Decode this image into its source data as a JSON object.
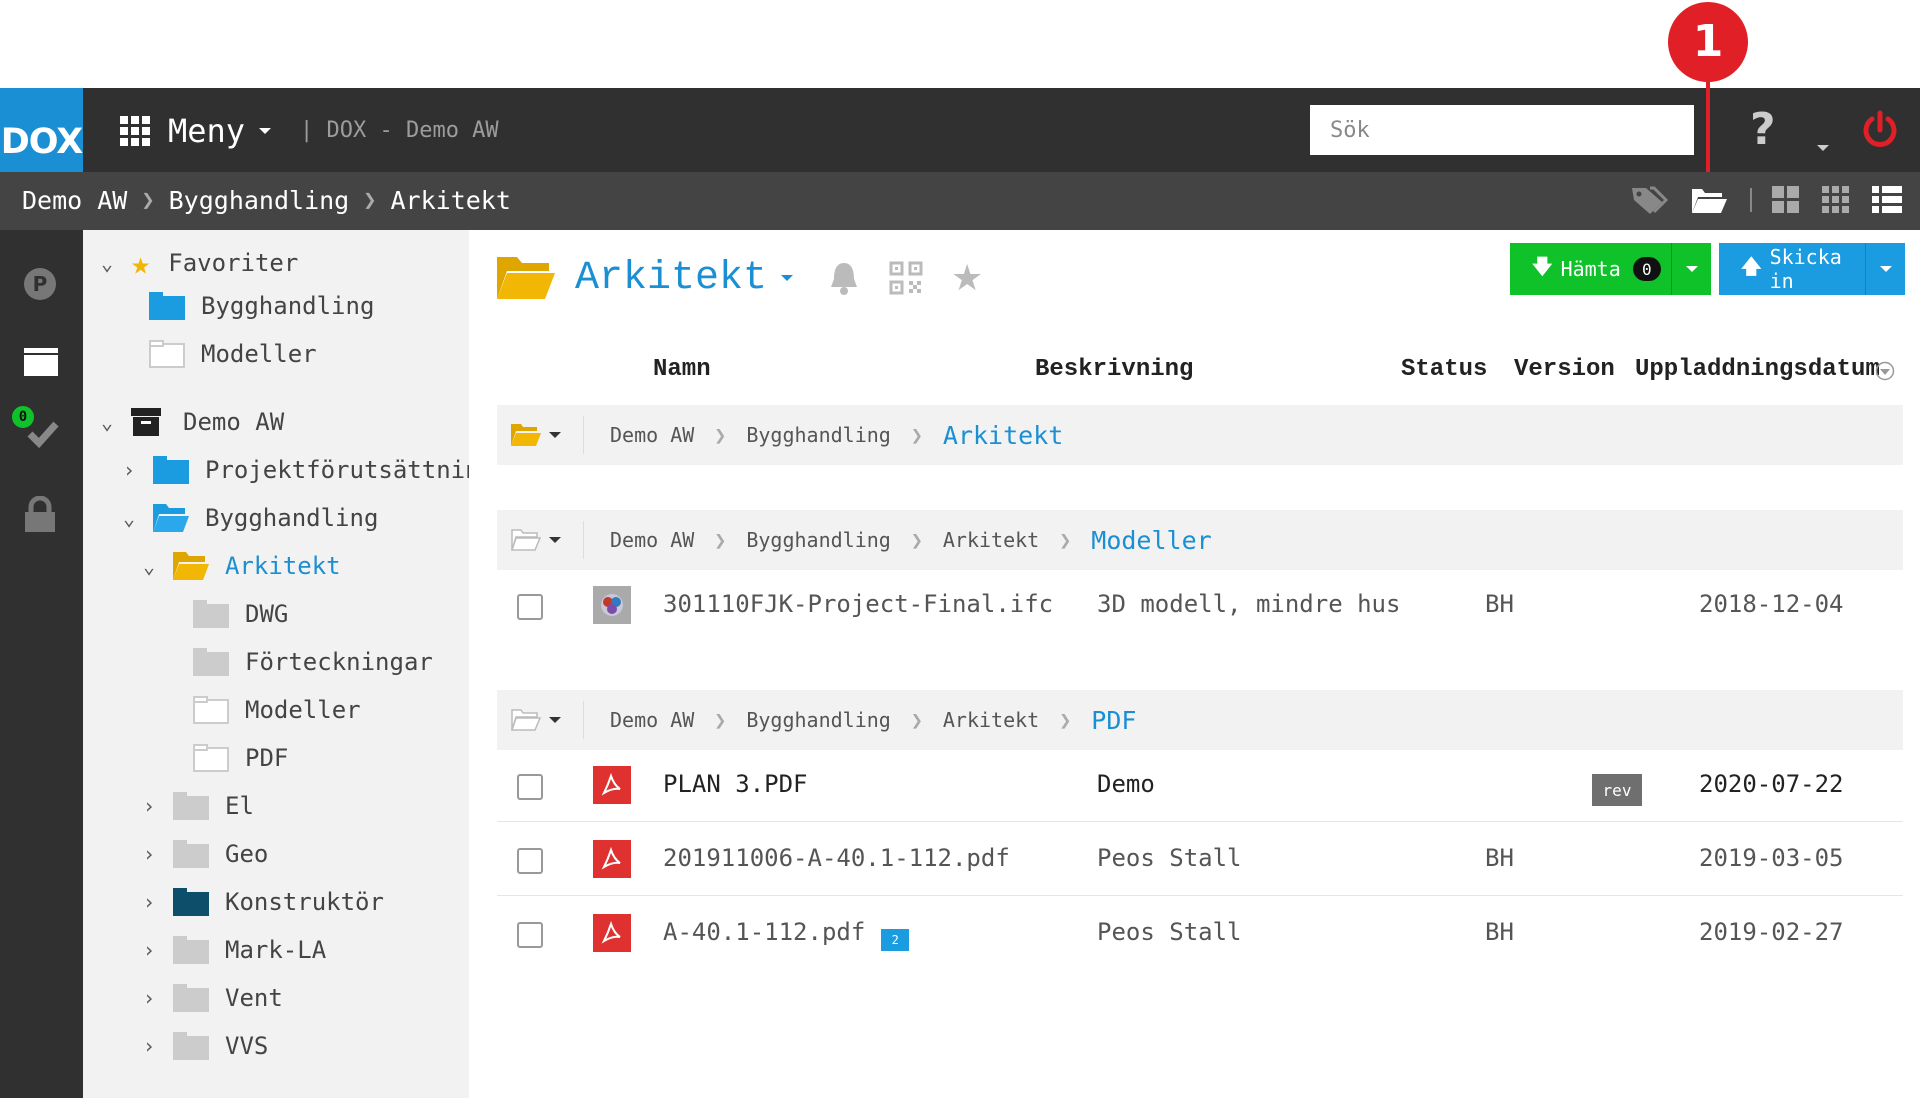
{
  "header": {
    "logo": "DOX",
    "menu_label": "Meny",
    "app_name": "| DOX - Demo AW",
    "search_placeholder": "Sök",
    "help_label": "?"
  },
  "callout": {
    "number": "1"
  },
  "breadcrumb": [
    "Demo AW",
    "Bygghandling",
    "Arkitekt"
  ],
  "toolbar_icons": [
    "tags-icon",
    "open-folder-icon",
    "large-grid-icon",
    "small-grid-icon",
    "list-view-icon"
  ],
  "rail": {
    "tasks_badge": "0"
  },
  "tree": {
    "favorites_label": "Favoriter",
    "favorites": [
      "Bygghandling",
      "Modeller"
    ],
    "project_label": "Demo AW",
    "folders": {
      "projekt": "Projektförutsättningar",
      "bygg": "Bygghandling",
      "arkitekt": "Arkitekt",
      "dwg": "DWG",
      "forteck": "Förteckningar",
      "modeller": "Modeller",
      "pdf": "PDF",
      "el": "El",
      "geo": "Geo",
      "konstr": "Konstruktör",
      "mark": "Mark-LA",
      "vent": "Vent",
      "vvs": "VVS"
    }
  },
  "main": {
    "title": "Arkitekt",
    "btn_hamta": "Hämta",
    "hamta_count": "0",
    "btn_skicka": "Skicka in",
    "columns": {
      "name": "Namn",
      "desc": "Beskrivning",
      "status": "Status",
      "version": "Version",
      "date": "Uppladdningsdatum"
    }
  },
  "groups": [
    {
      "path": [
        "Demo AW",
        "Bygghandling"
      ],
      "leaf": "Arkitekt"
    },
    {
      "path": [
        "Demo AW",
        "Bygghandling",
        "Arkitekt"
      ],
      "leaf": "Modeller"
    },
    {
      "path": [
        "Demo AW",
        "Bygghandling",
        "Arkitekt"
      ],
      "leaf": "PDF"
    }
  ],
  "files": [
    {
      "name": "301110FJK-Project-Final.ifc",
      "desc": "3D modell, mindre hus",
      "status": "BH",
      "date": "2018-12-04"
    },
    {
      "name": "PLAN 3.PDF",
      "desc": "Demo",
      "version": "rev",
      "date": "2020-07-22"
    },
    {
      "name": "201911006-A-40.1-112.pdf",
      "desc": "Peos Stall",
      "status": "BH",
      "date": "2019-03-05"
    },
    {
      "name": "A-40.1-112.pdf",
      "desc": "Peos Stall",
      "status": "BH",
      "date": "2019-02-27",
      "comments": "2"
    }
  ],
  "colors": {
    "accent": "#1b8fd3",
    "green": "#10c22a",
    "dark": "#303030",
    "callout": "#e01f26",
    "folder_yellow": "#f2b705"
  }
}
